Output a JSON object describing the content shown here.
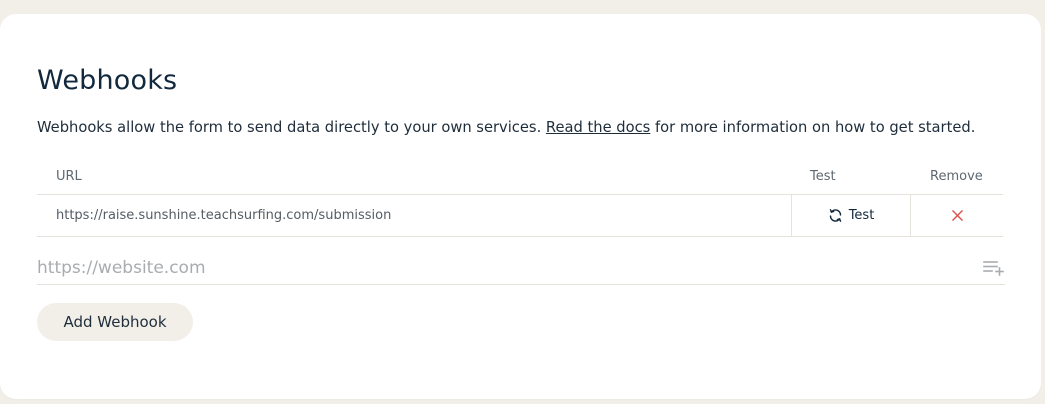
{
  "webhooks": {
    "title": "Webhooks",
    "description_before": "Webhooks allow the form to send data directly to your own services. ",
    "docs_link": "Read the docs",
    "description_after": " for more information on how to get started.",
    "table": {
      "columns": {
        "url": "URL",
        "test": "Test",
        "remove": "Remove"
      },
      "rows": [
        {
          "url": "https://raise.sunshine.teachsurfing.com/submission",
          "test_label": "Test",
          "remove_icon": "close-icon"
        }
      ]
    },
    "new_url": {
      "value": "",
      "placeholder": "https://website.com"
    },
    "add_button": "Add Webhook"
  },
  "icons": {
    "test": "refresh-icon",
    "remove": "close-icon",
    "add_to_list": "playlist-add-icon"
  },
  "colors": {
    "remove": "#d9534f",
    "button_bg": "#f2efe9",
    "page_bg": "#f2efe9"
  }
}
